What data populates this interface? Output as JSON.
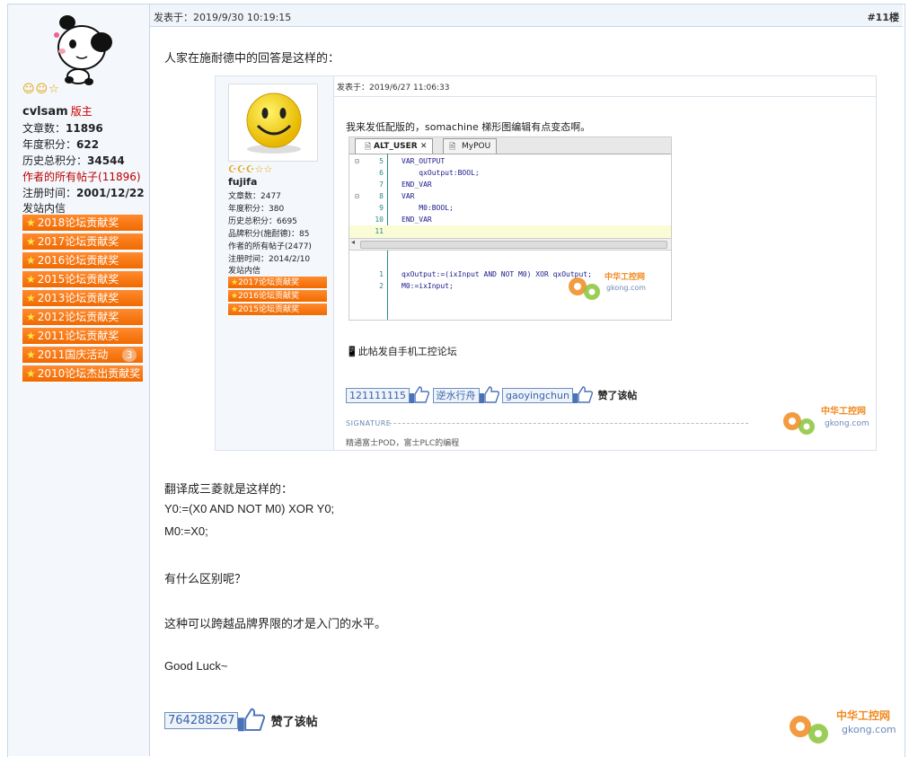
{
  "author": {
    "name": "cvlsam",
    "role": "版主",
    "stars": "☺☺☆",
    "posts_label": "文章数：",
    "posts": "11896",
    "year_points_label": "年度积分：",
    "year_points": "622",
    "total_points_label": "历史总积分：",
    "total_points": "34544",
    "all_posts_label": "作者的所有帖子",
    "all_posts_count": "(11896)",
    "reg_label": "注册时间：",
    "reg_date": "2001/12/22",
    "message_link": "发站内信",
    "awards": [
      "2018论坛贡献奖",
      "2017论坛贡献奖",
      "2016论坛贡献奖",
      "2015论坛贡献奖",
      "2013论坛贡献奖",
      "2012论坛贡献奖",
      "2011论坛贡献奖",
      "2011国庆活动",
      "2010论坛杰出贡献奖"
    ],
    "award_badge": "3"
  },
  "post": {
    "time": "发表于：2019/9/30 10:19:15",
    "floor": "#11楼",
    "intro": "人家在施耐德中的回答是这样的：",
    "lines": [
      "翻译成三菱就是这样的：",
      "Y0:=(X0 AND  NOT  M0) XOR  Y0;",
      "M0:=X0;",
      "有什么区别呢？",
      "这种可以跨越品牌界限的才是入门的水平。",
      "Good Luck~"
    ],
    "likers": [
      "764288267"
    ],
    "like_text": "赞了该帖"
  },
  "quote": {
    "time": "发表于：2019/6/27 11:06:33",
    "author": {
      "name": "fujifa",
      "stars": "☪☪☪☆☆",
      "posts": "文章数：2477",
      "year_points": "年度积分：380",
      "total_points": "历史总积分：6695",
      "brand_points": "品牌积分(施耐德)：85",
      "all_posts": "作者的所有帖子(2477)",
      "reg": "注册时间：2014/2/10",
      "message": "发站内信",
      "awards": [
        "2017论坛贡献奖",
        "2016论坛贡献奖",
        "2015论坛贡献奖"
      ]
    },
    "text": "我来发低配版的，somachine 梯形图编辑有点变态啊。",
    "ide": {
      "tabs": [
        "ALT_USER",
        "MyPOU"
      ],
      "lines": [
        {
          "n": "5",
          "c": "VAR_OUTPUT"
        },
        {
          "n": "6",
          "c": "    qxOutput:BOOL;"
        },
        {
          "n": "7",
          "c": "END_VAR"
        },
        {
          "n": "8",
          "c": "VAR"
        },
        {
          "n": "9",
          "c": "    M0:BOOL;"
        },
        {
          "n": "10",
          "c": "END_VAR"
        },
        {
          "n": "11",
          "c": ""
        }
      ],
      "body": [
        {
          "n": "1",
          "c": "qxOutput:=(ixInput AND NOT M0) XOR qxOutput;"
        },
        {
          "n": "2",
          "c": "M0:=ixInput;"
        }
      ]
    },
    "mobile": "此帖发自手机工控论坛",
    "likers": [
      "121111115",
      "逆水行舟",
      "gaoyingchun"
    ],
    "like_text": "赞了该帖",
    "sig_label": "SIGNATURE",
    "signature": "精通富士POD，富士PLC的编程"
  },
  "watermark": {
    "cn": "中华工控网",
    "en": "gkong.com"
  }
}
